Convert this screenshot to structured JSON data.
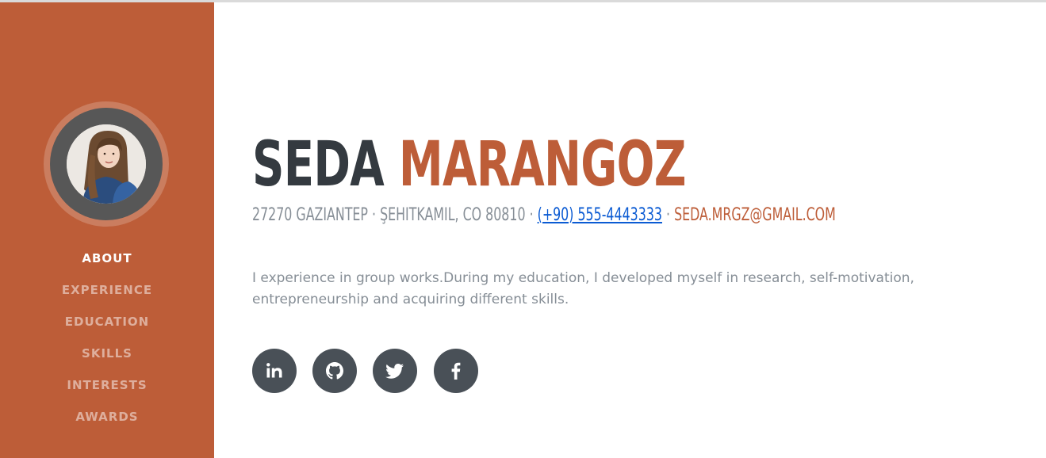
{
  "sidebar": {
    "nav": [
      {
        "label": "About",
        "active": true
      },
      {
        "label": "Experience",
        "active": false
      },
      {
        "label": "Education",
        "active": false
      },
      {
        "label": "Skills",
        "active": false
      },
      {
        "label": "Interests",
        "active": false
      },
      {
        "label": "Awards",
        "active": false
      }
    ]
  },
  "about": {
    "first_name": "Seda",
    "last_name": "Marangoz",
    "address": "27270 Gaziantep · Şehitkamil, CO 80810 · ",
    "phone": "(+90) 555-4443333",
    "separator": " · ",
    "email": "seda.mrgz@gmail.com",
    "bio": "I experience in group works.During my education, I developed myself in research, self-motivation, entrepreneurship and acquiring different skills."
  },
  "social": [
    {
      "name": "linkedin",
      "icon": "linkedin-icon"
    },
    {
      "name": "github",
      "icon": "github-icon"
    },
    {
      "name": "twitter",
      "icon": "twitter-icon"
    },
    {
      "name": "facebook",
      "icon": "facebook-icon"
    }
  ],
  "colors": {
    "primary": "#bd5d38",
    "dark": "#343a40",
    "muted": "#868e96",
    "social_bg": "#495057",
    "link": "#0b5bd3"
  }
}
